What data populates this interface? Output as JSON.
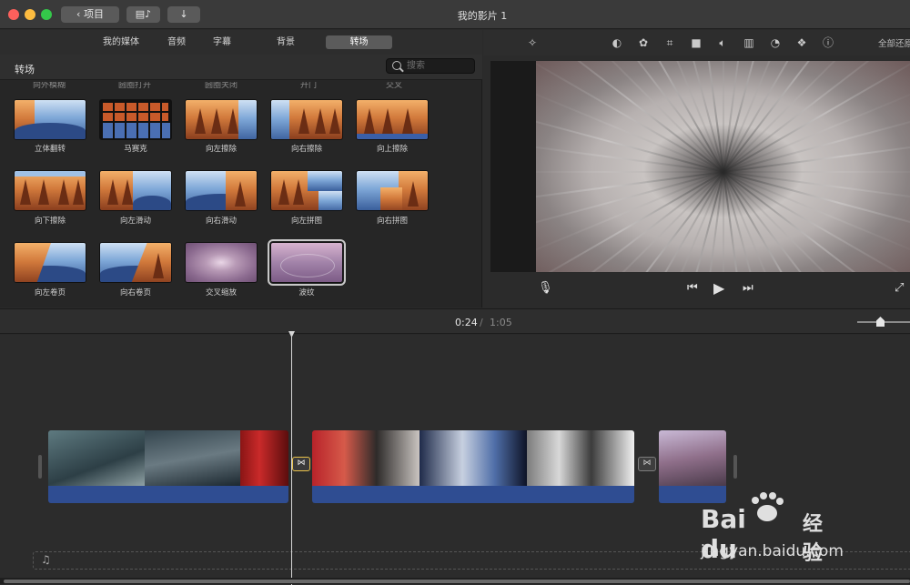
{
  "window": {
    "title": "我的影片 1",
    "back_label": "项目"
  },
  "browser": {
    "tabs": [
      "我的媒体",
      "音频",
      "字幕",
      "背景",
      "转场"
    ],
    "active_tab": "转场",
    "section_title": "转场",
    "search_placeholder": "搜索",
    "cut_labels": [
      "向外模糊",
      "圆圈打开",
      "圆圈关闭",
      "开门",
      "交叉"
    ],
    "transitions": [
      {
        "label": "立体翻转"
      },
      {
        "label": "马赛克"
      },
      {
        "label": "向左擦除"
      },
      {
        "label": "向右擦除"
      },
      {
        "label": "向上擦除"
      },
      {
        "label": "向下擦除"
      },
      {
        "label": "向左滑动"
      },
      {
        "label": "向右滑动"
      },
      {
        "label": "向左拼图"
      },
      {
        "label": "向右拼图"
      },
      {
        "label": "向左卷页"
      },
      {
        "label": "向右卷页"
      },
      {
        "label": "交叉缩放"
      },
      {
        "label": "波纹",
        "selected": true
      }
    ]
  },
  "viewer": {
    "reset_all_label": "全部还原",
    "tool_icons": [
      "magic-wand-icon",
      "color-balance-icon",
      "palette-icon",
      "crop-icon",
      "camera-icon",
      "volume-icon",
      "equalizer-icon",
      "speed-icon",
      "filter-icon",
      "info-icon"
    ]
  },
  "timeline": {
    "current_time": "0:24",
    "separator": "/",
    "total_time": "1:05"
  },
  "watermark": {
    "brand": "Bai du",
    "product": "经验",
    "url": "jingyan.baidu.com"
  },
  "colors": {
    "accent_yellow": "#e8c14a",
    "audio_blue": "#2f4d92",
    "panel_bg": "#262626"
  }
}
